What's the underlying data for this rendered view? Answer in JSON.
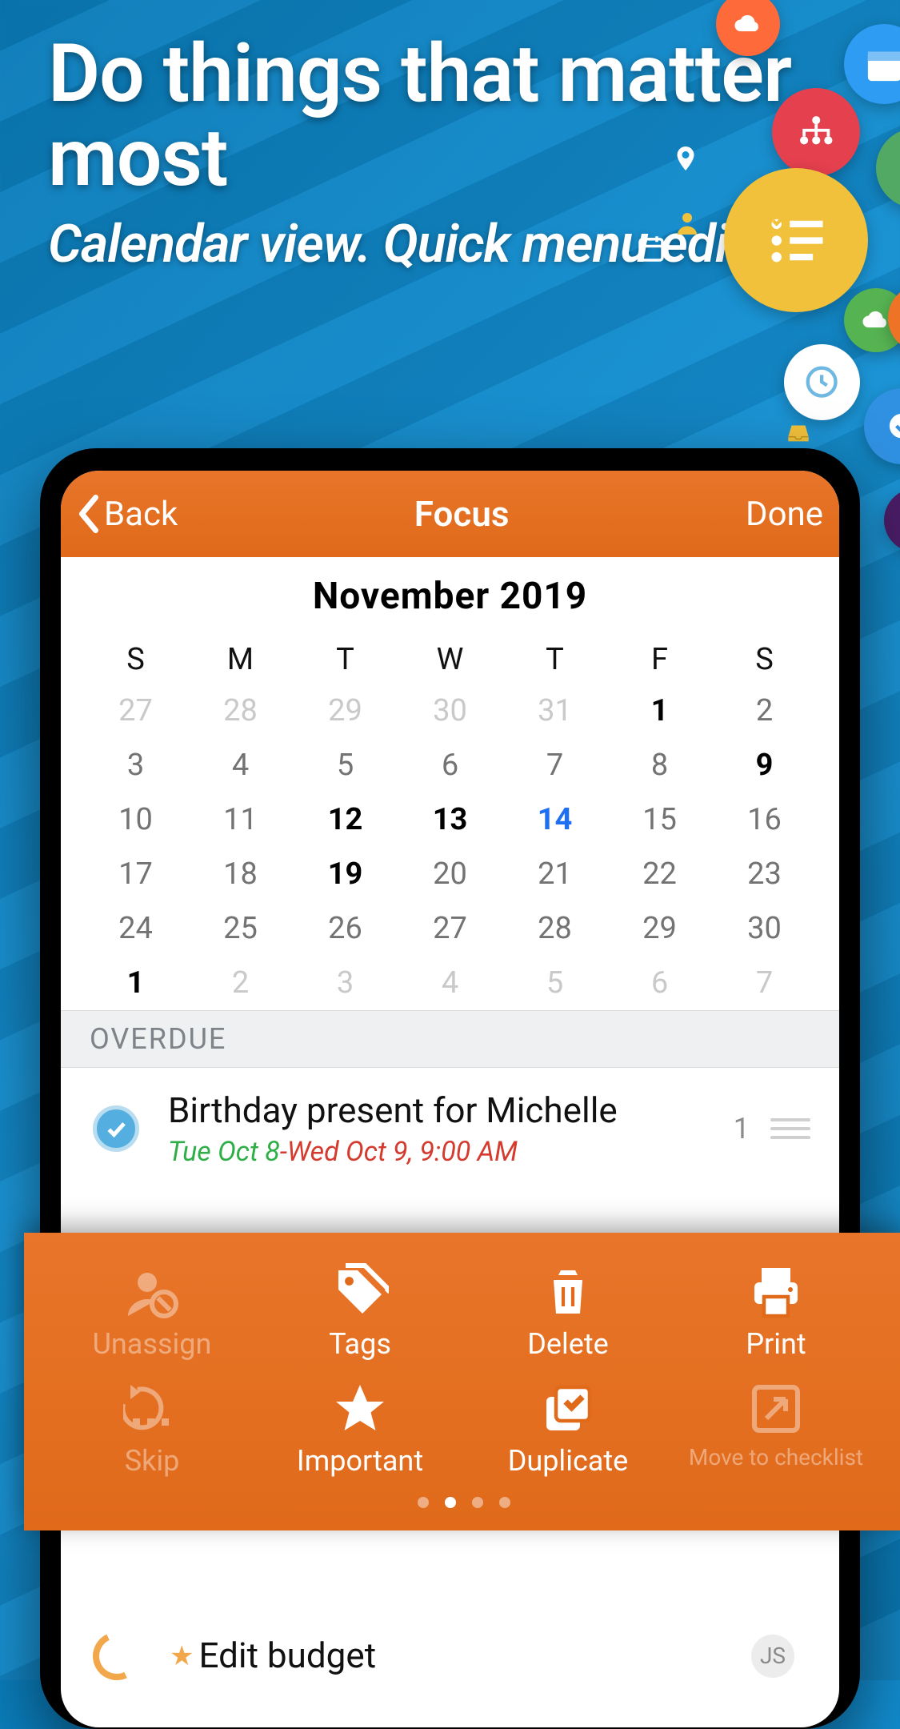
{
  "marketing": {
    "headline": "Do things that matter most",
    "subline": "Calendar view. Quick menu editing"
  },
  "navbar": {
    "back_label": "Back",
    "title": "Focus",
    "done_label": "Done"
  },
  "calendar": {
    "month_label": "November  2019",
    "dow": [
      "S",
      "M",
      "T",
      "W",
      "T",
      "F",
      "S"
    ],
    "weeks": [
      [
        {
          "n": "27",
          "s": "faded"
        },
        {
          "n": "28",
          "s": "faded"
        },
        {
          "n": "29",
          "s": "faded"
        },
        {
          "n": "30",
          "s": "faded"
        },
        {
          "n": "31",
          "s": "faded"
        },
        {
          "n": "1",
          "s": "bold"
        },
        {
          "n": "2",
          "s": ""
        }
      ],
      [
        {
          "n": "3",
          "s": ""
        },
        {
          "n": "4",
          "s": ""
        },
        {
          "n": "5",
          "s": ""
        },
        {
          "n": "6",
          "s": ""
        },
        {
          "n": "7",
          "s": ""
        },
        {
          "n": "8",
          "s": ""
        },
        {
          "n": "9",
          "s": "bold"
        }
      ],
      [
        {
          "n": "10",
          "s": ""
        },
        {
          "n": "11",
          "s": ""
        },
        {
          "n": "12",
          "s": "bold"
        },
        {
          "n": "13",
          "s": "bold"
        },
        {
          "n": "14",
          "s": "selected"
        },
        {
          "n": "15",
          "s": ""
        },
        {
          "n": "16",
          "s": ""
        }
      ],
      [
        {
          "n": "17",
          "s": ""
        },
        {
          "n": "18",
          "s": ""
        },
        {
          "n": "19",
          "s": "bold"
        },
        {
          "n": "20",
          "s": ""
        },
        {
          "n": "21",
          "s": ""
        },
        {
          "n": "22",
          "s": ""
        },
        {
          "n": "23",
          "s": ""
        }
      ],
      [
        {
          "n": "24",
          "s": ""
        },
        {
          "n": "25",
          "s": ""
        },
        {
          "n": "26",
          "s": ""
        },
        {
          "n": "27",
          "s": ""
        },
        {
          "n": "28",
          "s": ""
        },
        {
          "n": "29",
          "s": ""
        },
        {
          "n": "30",
          "s": ""
        }
      ],
      [
        {
          "n": "1",
          "s": "bold"
        },
        {
          "n": "2",
          "s": "faded"
        },
        {
          "n": "3",
          "s": "faded"
        },
        {
          "n": "4",
          "s": "faded"
        },
        {
          "n": "5",
          "s": "faded"
        },
        {
          "n": "6",
          "s": "faded"
        },
        {
          "n": "7",
          "s": "faded"
        }
      ]
    ]
  },
  "sections": {
    "overdue_label": "OVERDUE"
  },
  "tasks": {
    "first": {
      "title": "Birthday present for Michelle",
      "date_start": "Tue Oct 8",
      "date_sep": "-",
      "date_end": "Wed Oct 9, 9:00 AM",
      "count": "1"
    },
    "second": {
      "title": "Edit budget",
      "avatar_initials": "JS"
    }
  },
  "quick_menu": {
    "unassign": "Unassign",
    "tags": "Tags",
    "delete": "Delete",
    "print": "Print",
    "skip": "Skip",
    "important": "Important",
    "duplicate": "Duplicate",
    "move_to_checklist": "Move to checklist",
    "active_page_index": 1,
    "page_count": 4
  }
}
